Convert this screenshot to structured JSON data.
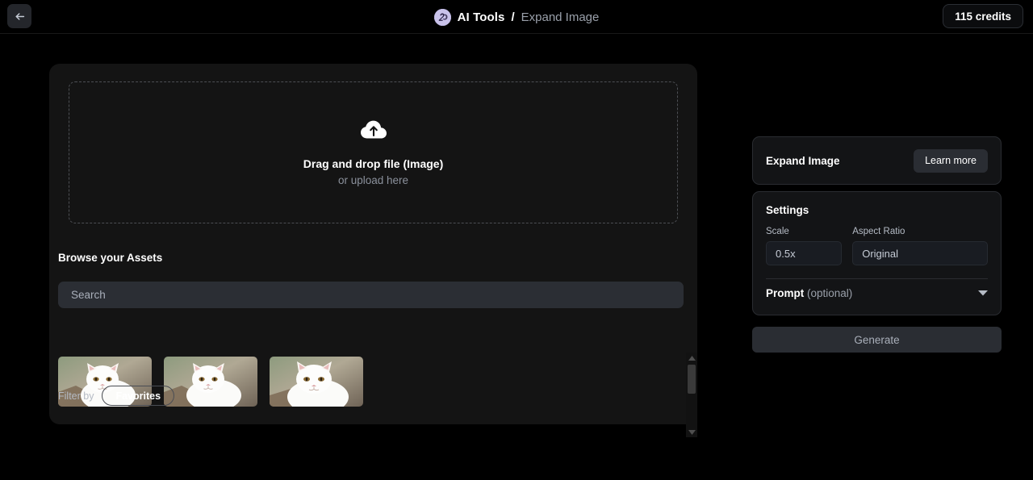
{
  "header": {
    "back_icon": "arrow-left-icon",
    "logo_icon": "ai-tools-logo-icon",
    "brand": "AI Tools",
    "separator": "/",
    "page": "Expand Image",
    "credits": "115 credits"
  },
  "upload": {
    "icon": "cloud-upload-icon",
    "title": "Drag and drop file (Image)",
    "subtitle": "or upload here"
  },
  "assets": {
    "heading": "Browse your Assets",
    "search_placeholder": "Search",
    "search_value": "",
    "filter_label": "Filter by",
    "filter_chip": "Favorites",
    "thumbnails": [
      {
        "alt": "white-cat-photo-1"
      },
      {
        "alt": "white-cat-photo-2"
      },
      {
        "alt": "white-cat-photo-3"
      }
    ],
    "scrollbar": {
      "up_icon": "caret-up-icon",
      "down_icon": "caret-down-icon"
    }
  },
  "panel": {
    "tool_title": "Expand Image",
    "learn_more": "Learn more",
    "settings_title": "Settings",
    "fields": [
      {
        "label": "Scale",
        "value": "0.5x"
      },
      {
        "label": "Aspect Ratio",
        "value": "Original"
      }
    ],
    "prompt_label": "Prompt",
    "prompt_optional": "(optional)",
    "prompt_chevron_icon": "chevron-down-icon",
    "generate": "Generate"
  },
  "colors": {
    "background": "#000000",
    "card": "#141414",
    "panel": "#131416",
    "input": "#191c22",
    "button": "#2a2d33",
    "accent_logo": "#c3bce8",
    "muted_text": "#9aa0aa"
  }
}
